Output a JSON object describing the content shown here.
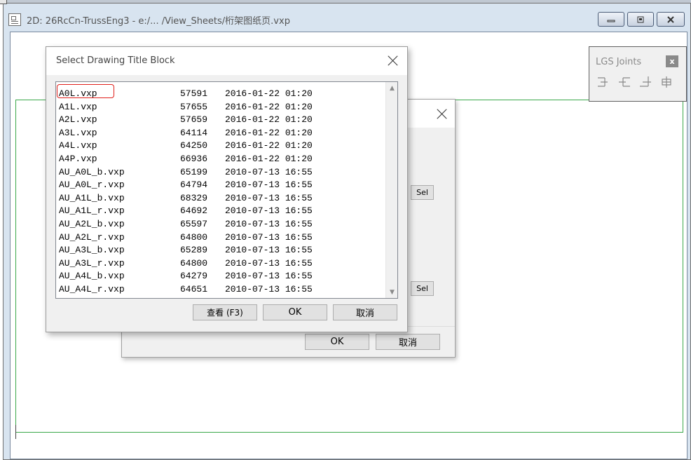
{
  "window": {
    "title": "2D: 26RcCn-TrussEng3 - e:/... /View_Sheets/桁架图纸页.vxp"
  },
  "lgs_panel": {
    "title": "LGS Joints",
    "close": "x",
    "icons": [
      "joint-left-icon",
      "joint-right-icon",
      "joint-corner-icon",
      "joint-cross-icon"
    ]
  },
  "back_dialog": {
    "sel_label_1": "Sel",
    "sel_label_2": "Sel",
    "ok_label": "OK",
    "cancel_label": "取消"
  },
  "front_dialog": {
    "title": "Select Drawing Title Block",
    "view_label": "查看 (F3)",
    "ok_label": "OK",
    "cancel_label": "取消",
    "files": [
      {
        "name": "A0L.vxp",
        "size": "57591",
        "date": "2016-01-22 01:20"
      },
      {
        "name": "A1L.vxp",
        "size": "57655",
        "date": "2016-01-22 01:20"
      },
      {
        "name": "A2L.vxp",
        "size": "57659",
        "date": "2016-01-22 01:20"
      },
      {
        "name": "A3L.vxp",
        "size": "64114",
        "date": "2016-01-22 01:20"
      },
      {
        "name": "A4L.vxp",
        "size": "64250",
        "date": "2016-01-22 01:20"
      },
      {
        "name": "A4P.vxp",
        "size": "66936",
        "date": "2016-01-22 01:20"
      },
      {
        "name": "AU_A0L_b.vxp",
        "size": "65199",
        "date": "2010-07-13 16:55"
      },
      {
        "name": "AU_A0L_r.vxp",
        "size": "64794",
        "date": "2010-07-13 16:55"
      },
      {
        "name": "AU_A1L_b.vxp",
        "size": "68329",
        "date": "2010-07-13 16:55"
      },
      {
        "name": "AU_A1L_r.vxp",
        "size": "64692",
        "date": "2010-07-13 16:55"
      },
      {
        "name": "AU_A2L_b.vxp",
        "size": "65597",
        "date": "2010-07-13 16:55"
      },
      {
        "name": "AU_A2L_r.vxp",
        "size": "64800",
        "date": "2010-07-13 16:55"
      },
      {
        "name": "AU_A3L_b.vxp",
        "size": "65289",
        "date": "2010-07-13 16:55"
      },
      {
        "name": "AU_A3L_r.vxp",
        "size": "64800",
        "date": "2010-07-13 16:55"
      },
      {
        "name": "AU_A4L_b.vxp",
        "size": "64279",
        "date": "2010-07-13 16:55"
      },
      {
        "name": "AU_A4L_r.vxp",
        "size": "64651",
        "date": "2010-07-13 16:55"
      }
    ]
  },
  "colors": {
    "sheet_frame": "#3aa84a",
    "highlight": "#e0201c"
  }
}
